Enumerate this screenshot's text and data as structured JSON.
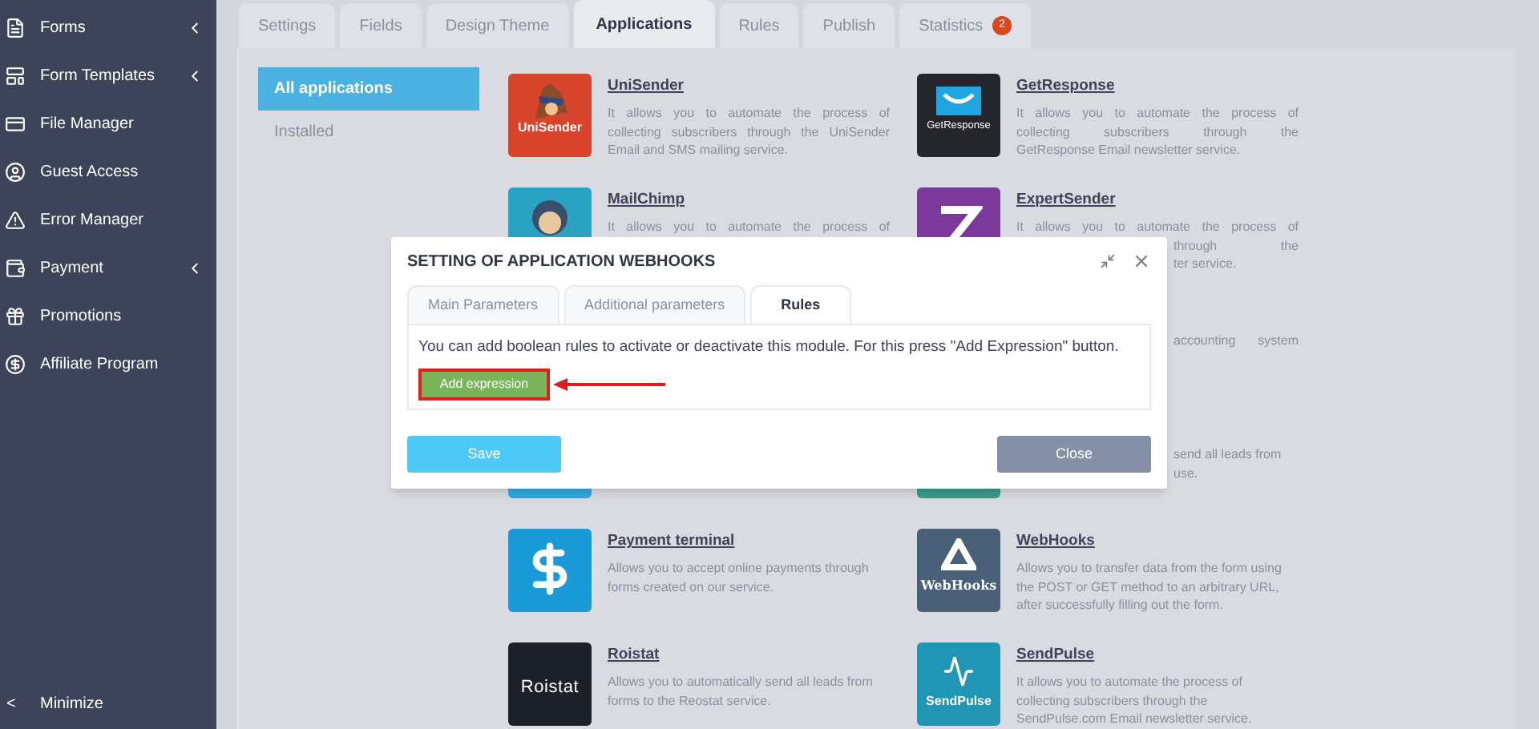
{
  "sidebar": {
    "items": [
      {
        "label": "Forms",
        "has_submenu": true
      },
      {
        "label": "Form Templates",
        "has_submenu": true
      },
      {
        "label": "File Manager",
        "has_submenu": false
      },
      {
        "label": "Guest Access",
        "has_submenu": false
      },
      {
        "label": "Error Manager",
        "has_submenu": false
      },
      {
        "label": "Payment",
        "has_submenu": true
      },
      {
        "label": "Promotions",
        "has_submenu": false
      },
      {
        "label": "Affiliate Program",
        "has_submenu": false
      }
    ],
    "footer": {
      "icon": "<",
      "label": "Minimize"
    }
  },
  "tabs": [
    {
      "label": "Settings",
      "selected": false
    },
    {
      "label": "Fields",
      "selected": false
    },
    {
      "label": "Design Theme",
      "selected": false
    },
    {
      "label": "Applications",
      "selected": true
    },
    {
      "label": "Rules",
      "selected": false
    },
    {
      "label": "Publish",
      "selected": false
    },
    {
      "label": "Statistics",
      "selected": false,
      "badge": "2"
    }
  ],
  "app_menu": [
    {
      "label": "All applications",
      "selected": true
    },
    {
      "label": "Installed",
      "selected": false
    }
  ],
  "app_rows": [
    {
      "left": {
        "title": "UniSender",
        "color": "#d8442b",
        "logo_text": "UniSender",
        "lines": [
          {
            "text": "It allows you to automate the process of",
            "kind": "justify"
          },
          {
            "text": "collecting subscribers through the UniSender",
            "kind": "justify"
          },
          {
            "text": "Email and SMS mailing service.",
            "kind": "plain"
          }
        ]
      },
      "right": {
        "title": "GetResponse",
        "color": "#25262b",
        "logo_text": "GetResponse",
        "lines": [
          {
            "text": "It allows you to automate the process of",
            "kind": "justify"
          },
          {
            "text": "collecting subscribers through the",
            "kind": "justify"
          },
          {
            "text": "GetResponse Email newsletter service.",
            "kind": "plain"
          }
        ]
      }
    },
    {
      "left": {
        "title": "MailChimp",
        "color": "#2aa3c2",
        "lines": [
          {
            "text": "It allows you to automate the process of",
            "kind": "justify"
          }
        ]
      },
      "right": {
        "title": "ExpertSender",
        "color": "#7b3a9b",
        "lines": [
          {
            "text": "It allows you to automate the process of",
            "kind": "justify"
          },
          {
            "text": "through the",
            "kind": "cut_justify"
          },
          {
            "text": "ter service.",
            "kind": "cut"
          }
        ]
      }
    },
    {
      "right": {
        "lines": [
          {
            "text": "accounting system",
            "kind": "cut_justify"
          }
        ]
      }
    },
    {
      "left": {
        "color": "#2fa9de"
      },
      "right": {
        "color": "#3a9b8b",
        "lines": [
          {
            "text": "send all leads from",
            "kind": "cut"
          },
          {
            "text": "use.",
            "kind": "cut"
          }
        ]
      }
    },
    {
      "left": {
        "title": "Payment terminal",
        "color": "#1a9ad6",
        "lines": [
          {
            "text": "Allows you to accept online payments through",
            "kind": "plain"
          },
          {
            "text": "forms created on our service.",
            "kind": "plain"
          }
        ]
      },
      "right": {
        "title": "WebHooks",
        "color": "#4a6079",
        "logo_text": "WebHooks",
        "lines": [
          {
            "text": "Allows you to transfer data from the form using",
            "kind": "plain"
          },
          {
            "text": "the POST or GET method to an arbitrary URL,",
            "kind": "plain"
          },
          {
            "text": "after successfully filling out the form.",
            "kind": "plain"
          }
        ]
      }
    },
    {
      "left": {
        "title": "Roistat",
        "color": "#1c2028",
        "logo_text": "Roistat",
        "lines": [
          {
            "text": "Allows you to automatically send all leads from",
            "kind": "plain"
          },
          {
            "text": "forms to the Reostat service.",
            "kind": "plain"
          }
        ]
      },
      "right": {
        "title": "SendPulse",
        "color": "#2196b4",
        "logo_text": "SendPulse",
        "lines": [
          {
            "text": "It allows you to automate the process of",
            "kind": "plain"
          },
          {
            "text": "collecting subscribers through the",
            "kind": "plain"
          },
          {
            "text": "SendPulse.com Email newsletter service.",
            "kind": "plain"
          }
        ]
      }
    }
  ],
  "dialog": {
    "title": "SETTING OF APPLICATION WEBHOOKS",
    "tabs": [
      {
        "label": "Main Parameters",
        "selected": false
      },
      {
        "label": "Additional parameters",
        "selected": false
      },
      {
        "label": "Rules",
        "selected": true
      }
    ],
    "message": "You can add boolean rules to activate or deactivate this module. For this press \"Add Expression\" button.",
    "add_button": {
      "label": "Add expression",
      "highlighted": true
    },
    "buttons": [
      {
        "label": "Save",
        "kind": "primary"
      },
      {
        "label": "Close",
        "kind": "secondary"
      }
    ]
  }
}
